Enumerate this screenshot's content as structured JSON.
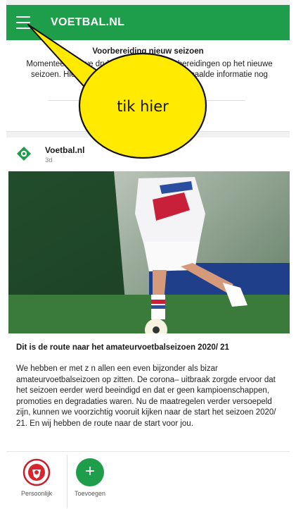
{
  "app": {
    "title": "VOETBAL.NL",
    "brand_color": "#1e9e4a",
    "menu_icon": "hamburger-menu-icon"
  },
  "notice": {
    "title": "Voorbereiding nieuw seizoen",
    "body": "Momenteel zijn we druk bezig met de voorbereidingen op het nieuwe seizoen. Hierdoor kan het voorkomen dat bepaalde informatie nog niet volledig zichtbaar is."
  },
  "post": {
    "author": "Voetbal.nl",
    "age": "3d",
    "author_icon": "voetbal-logo-icon",
    "title": "Dit is de route naar het amateurvoetbalseizoen 2020/ 21",
    "text": "We hebben er met z n allen een even bijzonder als bizar amateurvoetbalseizoen op zitten. De corona– uitbraak zorgde ervoor dat het seizoen eerder werd beeindigd en dat er geen kampioenschappen, promoties en degradaties waren. Nu de maatregelen verder versoepeld zijn, kunnen we voorzichtig vooruit kijken naar de start het seizoen 2020/ 21. En wij hebben de route naar de start voor jou."
  },
  "bottom_nav": {
    "personal_label": "Persoonlijk",
    "add_label": "Toevoegen",
    "add_symbol": "+",
    "personal_icon": "club-crest-icon"
  },
  "annotation": {
    "text": "tik hier",
    "color": "#ffea00"
  }
}
